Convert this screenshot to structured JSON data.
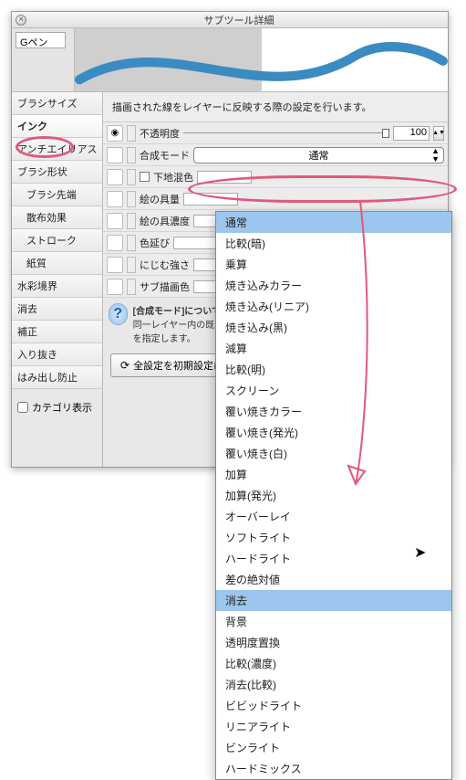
{
  "window": {
    "title": "サブツール詳細",
    "tool_name": "Gペン"
  },
  "sidebar": {
    "items": [
      {
        "label": "ブラシサイズ",
        "indent": false,
        "selected": false
      },
      {
        "label": "インク",
        "indent": false,
        "selected": true
      },
      {
        "label": "アンチエイリアス",
        "indent": false,
        "selected": false
      },
      {
        "label": "ブラシ形状",
        "indent": false,
        "selected": false
      },
      {
        "label": "ブラシ先端",
        "indent": true,
        "selected": false
      },
      {
        "label": "散布効果",
        "indent": true,
        "selected": false
      },
      {
        "label": "ストローク",
        "indent": true,
        "selected": false
      },
      {
        "label": "紙質",
        "indent": true,
        "selected": false
      },
      {
        "label": "水彩境界",
        "indent": false,
        "selected": false
      },
      {
        "label": "消去",
        "indent": false,
        "selected": false
      },
      {
        "label": "補正",
        "indent": false,
        "selected": false
      },
      {
        "label": "入り抜き",
        "indent": false,
        "selected": false
      },
      {
        "label": "はみ出し防止",
        "indent": false,
        "selected": false
      }
    ],
    "category_label": "カテゴリ表示"
  },
  "main": {
    "description": "描画された線をレイヤーに反映する際の設定を行います。",
    "opacity": {
      "label": "不透明度",
      "value": "100"
    },
    "blend": {
      "label": "合成モード",
      "value": "通常"
    },
    "rows": [
      {
        "label": "下地混色",
        "has_cb": true
      },
      {
        "label": "絵の具量",
        "has_cb": false
      },
      {
        "label": "絵の具濃度",
        "has_cb": false
      },
      {
        "label": "色延び",
        "has_cb": false
      },
      {
        "label": "にじむ強さ",
        "has_cb": false
      },
      {
        "label": "サブ描画色",
        "has_cb": false
      }
    ],
    "help": {
      "title": "[合成モード]について",
      "body": "同一レイヤー内の既に描かれている箇所に重ねて\nどのように影響させるかを指定します。"
    },
    "reset_label": "全設定を初期設定に戻す"
  },
  "dropdown": {
    "items": [
      "通常",
      "比較(暗)",
      "乗算",
      "焼き込みカラー",
      "焼き込み(リニア)",
      "焼き込み(黒)",
      "減算",
      "比較(明)",
      "スクリーン",
      "覆い焼きカラー",
      "覆い焼き(発光)",
      "覆い焼き(白)",
      "加算",
      "加算(発光)",
      "オーバーレイ",
      "ソフトライト",
      "ハードライト",
      "差の絶対値",
      "消去",
      "背景",
      "透明度置換",
      "比較(濃度)",
      "消去(比較)",
      "ビビッドライト",
      "リニアライト",
      "ビンライト",
      "ハードミックス"
    ],
    "highlight0": 0,
    "highlight1": 18
  },
  "colors": {
    "annotation": "#df5a7a",
    "stroke": "#3a8bc2"
  }
}
